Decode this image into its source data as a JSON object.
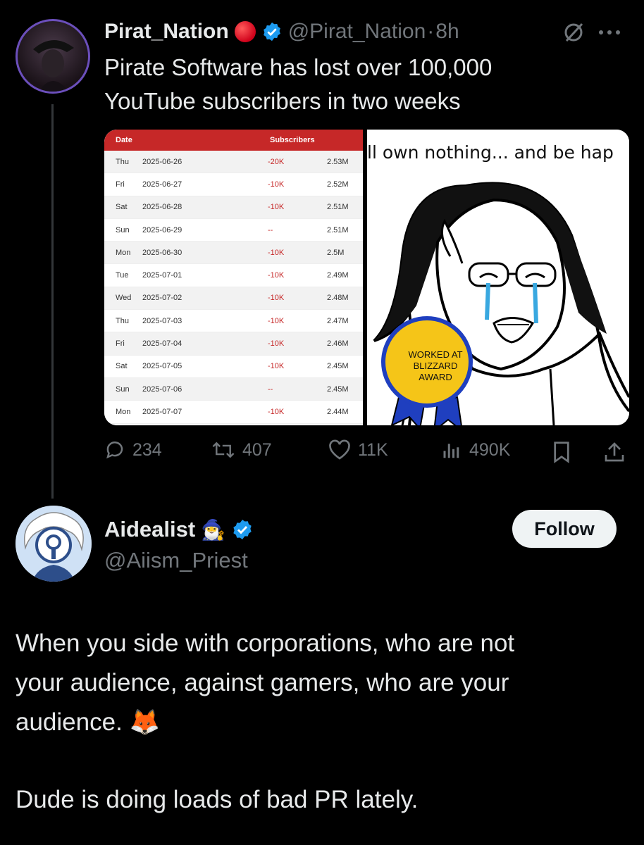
{
  "quoted": {
    "display_name": "Pirat_Nation",
    "handle": "@Pirat_Nation",
    "separator": "·",
    "time": "8h",
    "text_line1": "Pirate Software has lost over 100,000",
    "text_line2": "YouTube subscribers in two weeks",
    "table": {
      "header": {
        "date": "Date",
        "subscribers": "Subscribers"
      },
      "rows": [
        {
          "day": "Thu",
          "date": "2025-06-26",
          "change": "-20K",
          "total": "2.53M"
        },
        {
          "day": "Fri",
          "date": "2025-06-27",
          "change": "-10K",
          "total": "2.52M"
        },
        {
          "day": "Sat",
          "date": "2025-06-28",
          "change": "-10K",
          "total": "2.51M"
        },
        {
          "day": "Sun",
          "date": "2025-06-29",
          "change": "--",
          "total": "2.51M"
        },
        {
          "day": "Mon",
          "date": "2025-06-30",
          "change": "-10K",
          "total": "2.5M"
        },
        {
          "day": "Tue",
          "date": "2025-07-01",
          "change": "-10K",
          "total": "2.49M"
        },
        {
          "day": "Wed",
          "date": "2025-07-02",
          "change": "-10K",
          "total": "2.48M"
        },
        {
          "day": "Thu",
          "date": "2025-07-03",
          "change": "-10K",
          "total": "2.47M"
        },
        {
          "day": "Fri",
          "date": "2025-07-04",
          "change": "-10K",
          "total": "2.46M"
        },
        {
          "day": "Sat",
          "date": "2025-07-05",
          "change": "-10K",
          "total": "2.45M"
        },
        {
          "day": "Sun",
          "date": "2025-07-06",
          "change": "--",
          "total": "2.45M"
        },
        {
          "day": "Mon",
          "date": "2025-07-07",
          "change": "-10K",
          "total": "2.44M"
        }
      ]
    },
    "meme": {
      "caption": "ll own nothing... and be hap",
      "badge_line1": "WORKED AT",
      "badge_line2": "BLIZZARD",
      "badge_line3": "AWARD"
    },
    "stats": {
      "replies": "234",
      "reposts": "407",
      "likes": "11K",
      "views": "490K"
    }
  },
  "reply": {
    "display_name": "Aidealist",
    "name_emoji": "🧙‍♂️",
    "handle": "@Aiism_Priest",
    "follow_label": "Follow",
    "paragraph1_line1": "When you side with corporations, who are not",
    "paragraph1_line2": "your audience, against gamers, who are your",
    "paragraph1_line3": "audience.",
    "paragraph1_emoji": "🦊",
    "paragraph2": "Dude is doing loads of bad PR lately."
  },
  "colors": {
    "background": "#000000",
    "text": "#e7e9ea",
    "muted": "#71767b",
    "verified": "#1d9bf0",
    "table_header": "#c62828"
  }
}
